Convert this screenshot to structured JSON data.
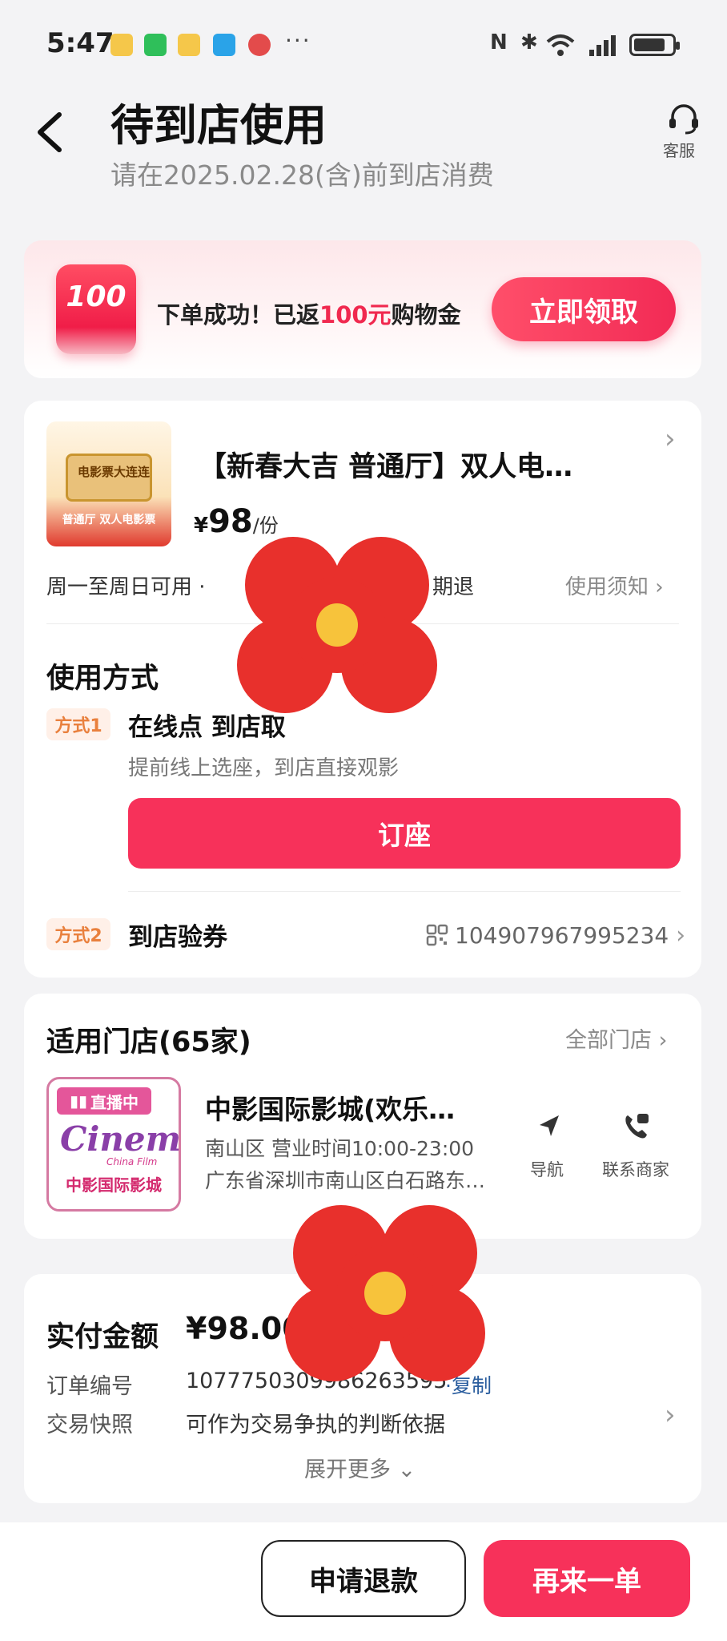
{
  "status_bar": {
    "time": "5:47",
    "dots": "···"
  },
  "header": {
    "title": "待到店使用",
    "subtitle": "请在2025.02.28(含)前到店消费",
    "service_label": "客服"
  },
  "banner": {
    "coupon_value": "100",
    "text_prefix": "下单成功！已返",
    "text_highlight": "100元",
    "text_suffix": "购物金",
    "claim_label": "立即领取"
  },
  "product": {
    "thumb_ticket_text": "电影票大连连",
    "thumb_label": "普通厅 双人电影票",
    "title": "【新春大吉 普通厅】双人电…",
    "price_symbol": "¥",
    "price": "98",
    "price_unit": "/份",
    "availability": "周一至周日可用 ·",
    "refund_policy": "期退",
    "notice_label": "使用须知"
  },
  "usage": {
    "section_title": "使用方式",
    "method1": {
      "tag": "方式1",
      "title": "在线点 到店取",
      "desc": "提前线上选座，到店直接观影",
      "button_label": "订座"
    },
    "method2": {
      "tag": "方式2",
      "title": "到店验券",
      "voucher_code": "104907967995234"
    }
  },
  "stores": {
    "section_title": "适用门店(65家)",
    "all_label": "全部门店",
    "store": {
      "live_badge": "直播中",
      "logo_word": "Cinema",
      "logo_sub": "China Film",
      "logo_cn": "中影国际影城",
      "name": "中影国际影城(欢乐…",
      "district_hours": "南山区  营业时间10:00-23:00",
      "address": "广东省深圳市南山区白石路东…",
      "nav_label": "导航",
      "call_label": "联系商家"
    }
  },
  "payment": {
    "label": "实付金额",
    "amount": "¥98.00",
    "order_label": "订单编号",
    "order_number": "1077750309986263595",
    "copy_label": "·复制",
    "snapshot_label": "交易快照",
    "snapshot_value": "可作为交易争执的判断依据",
    "expand_label": "展开更多"
  },
  "bottom": {
    "refund_label": "申请退款",
    "reorder_label": "再来一单"
  },
  "colors": {
    "accent": "#f7315a",
    "tag_text": "#e9803d",
    "link": "#2a5d9e"
  }
}
